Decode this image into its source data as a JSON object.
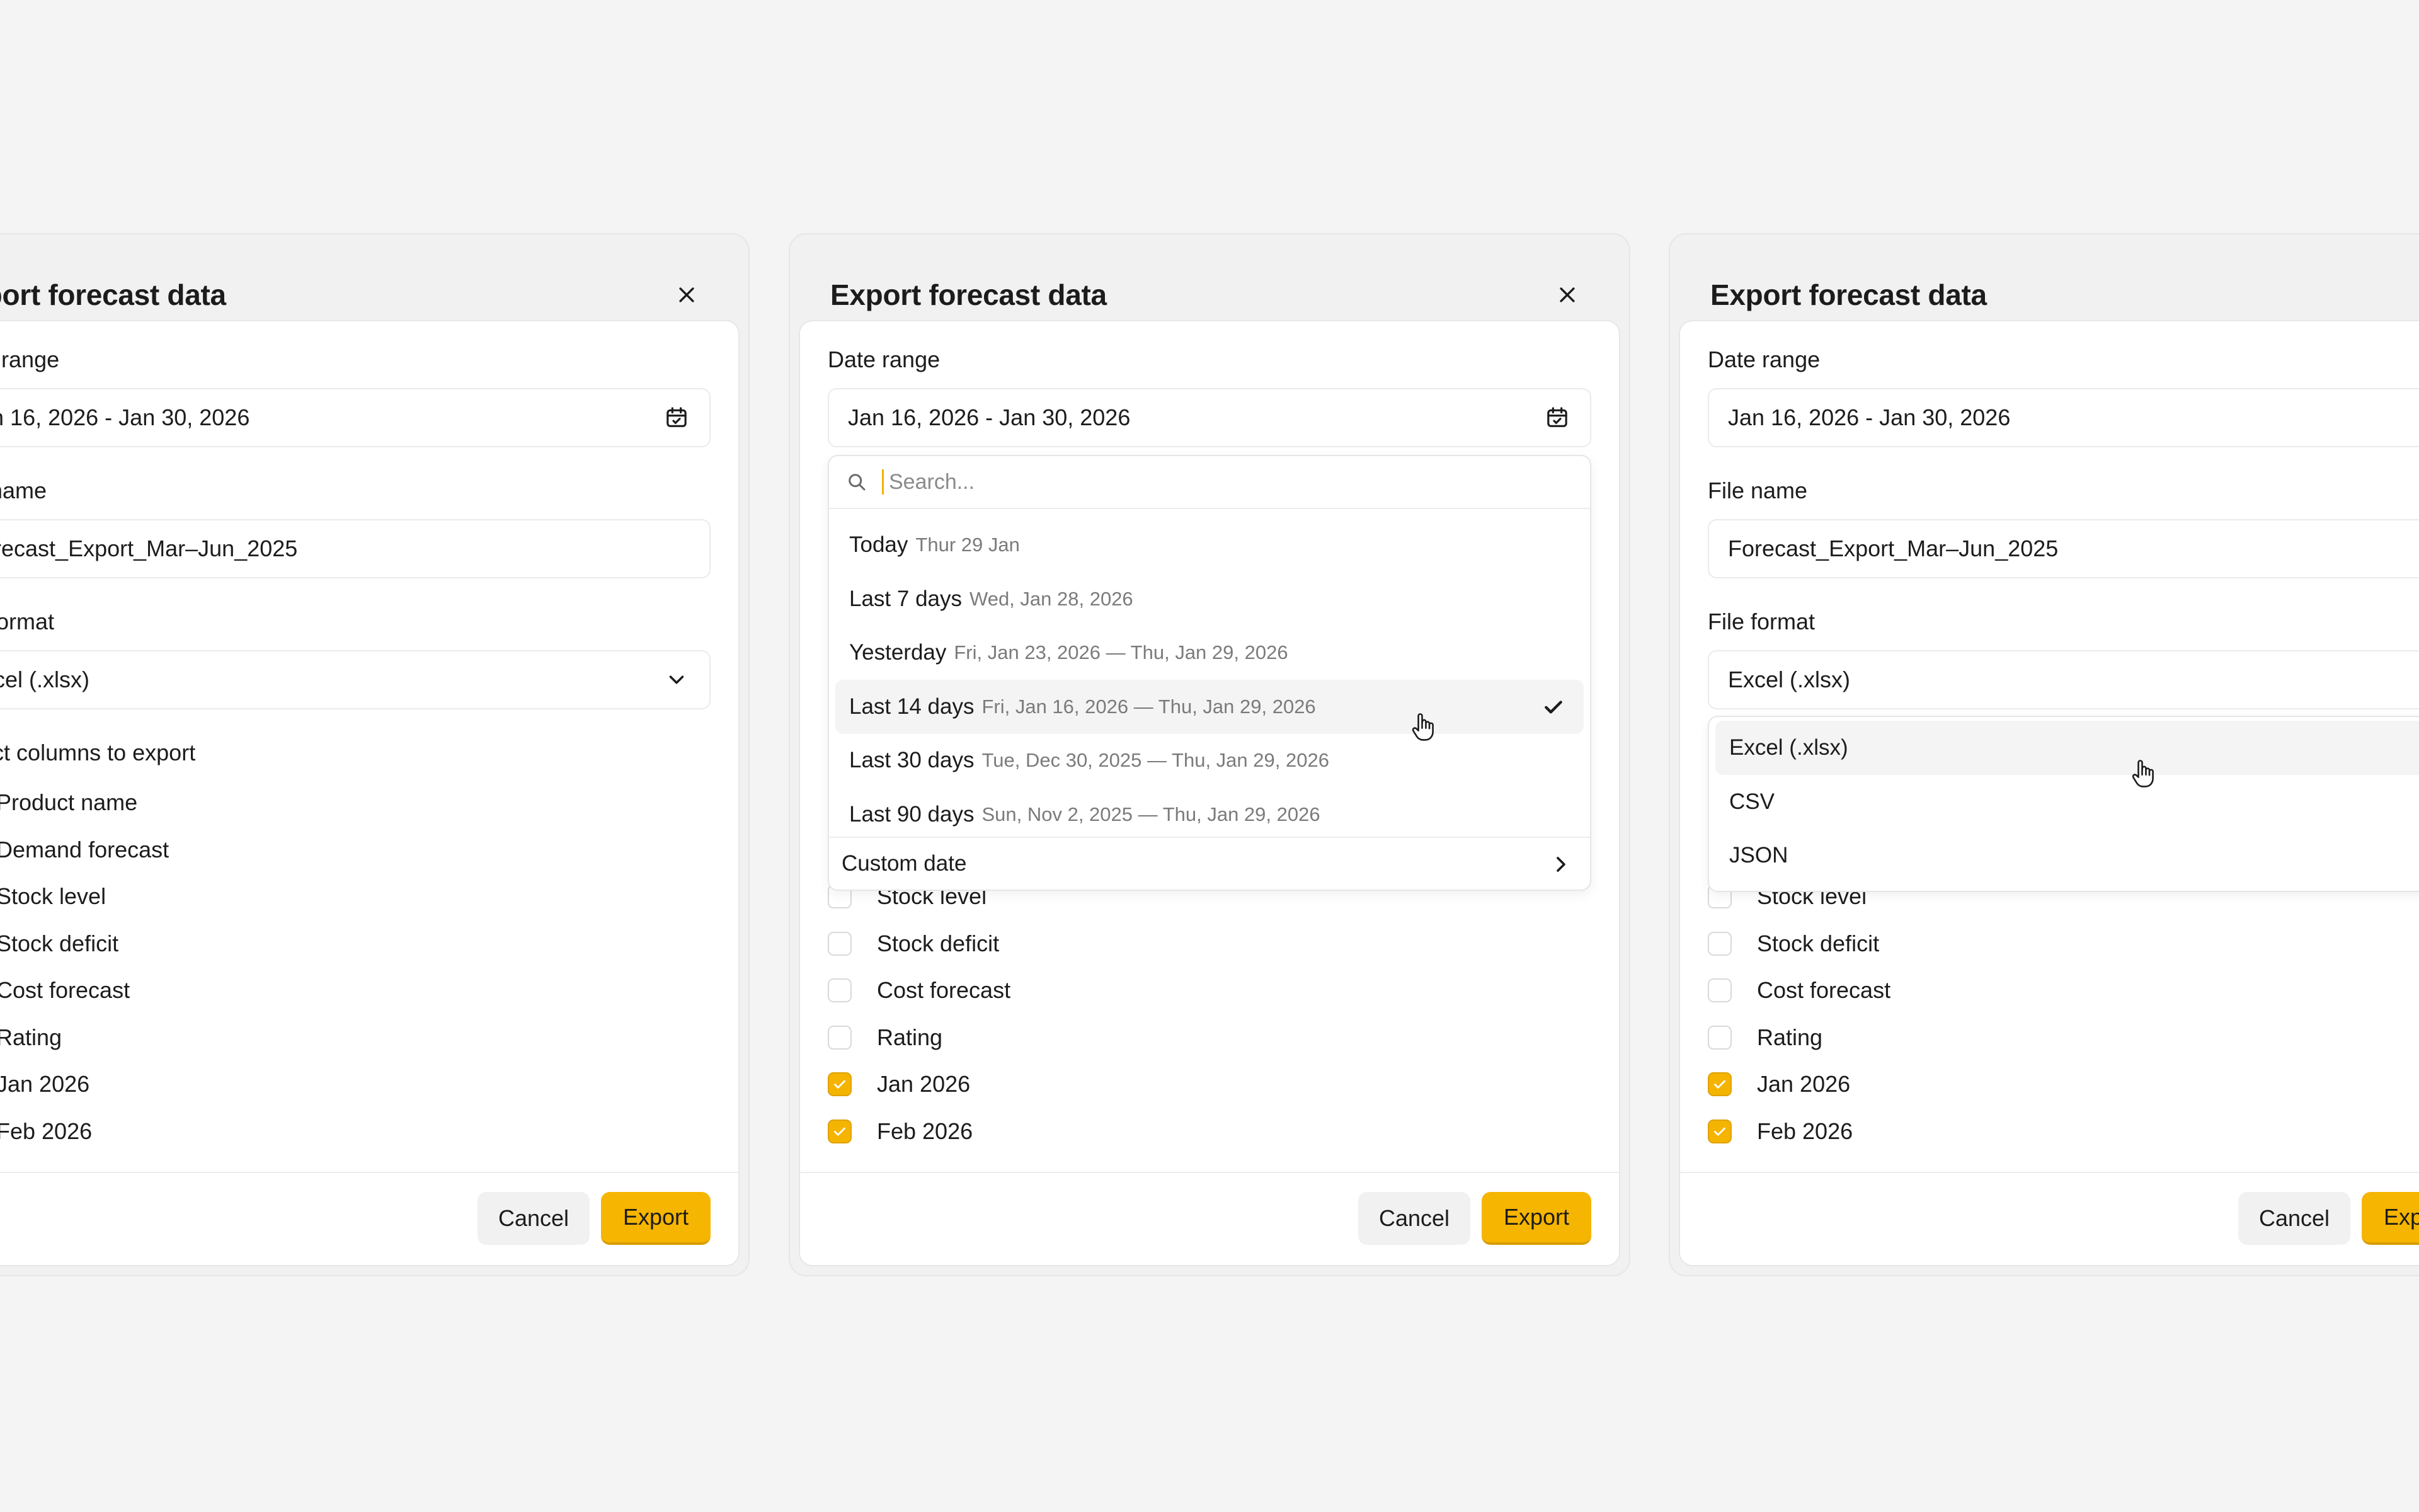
{
  "colors": {
    "accent": "#f6b500",
    "background": "#f4f4f4",
    "panel": "#ffffff"
  },
  "modal": {
    "title": "Export forecast data",
    "close_icon": "close-icon",
    "date_range_label": "Date range",
    "date_range_value": "Jan 16, 2026 - Jan 30, 2026",
    "file_name_label": "File name",
    "file_name_value": "Forecast_Export_Mar–Jun_2025",
    "file_format_label": "File format",
    "file_format_value": "Excel (.xlsx)",
    "columns_label": "Select columns to export",
    "columns": [
      {
        "label": "Product name",
        "checked": true
      },
      {
        "label": "Demand forecast",
        "checked": true
      },
      {
        "label": "Stock level",
        "checked": false
      },
      {
        "label": "Stock deficit",
        "checked": false
      },
      {
        "label": "Cost forecast",
        "checked": false
      },
      {
        "label": "Rating",
        "checked": false
      },
      {
        "label": "Jan 2026",
        "checked": true
      },
      {
        "label": "Feb 2026",
        "checked": true
      }
    ],
    "cancel_label": "Cancel",
    "export_label": "Export"
  },
  "date_dropdown": {
    "search_placeholder": "Search...",
    "items": [
      {
        "label": "Today",
        "sub": "Thur 29 Jan"
      },
      {
        "label": "Last 7 days",
        "sub": "Wed, Jan 28, 2026"
      },
      {
        "label": "Yesterday",
        "sub": "Fri, Jan 23, 2026 — Thu, Jan 29, 2026"
      },
      {
        "label": "Last 14 days",
        "sub": "Fri, Jan 16, 2026 — Thu, Jan 29, 2026",
        "selected": true
      },
      {
        "label": "Last 30 days",
        "sub": "Tue, Dec 30, 2025 — Thu, Jan 29, 2026"
      },
      {
        "label": "Last 90 days",
        "sub": "Sun, Nov 2, 2025 — Thu, Jan 29, 2026"
      }
    ],
    "custom_label": "Custom date"
  },
  "format_dropdown": {
    "items": [
      "Excel (.xlsx)",
      "CSV",
      "JSON"
    ]
  }
}
